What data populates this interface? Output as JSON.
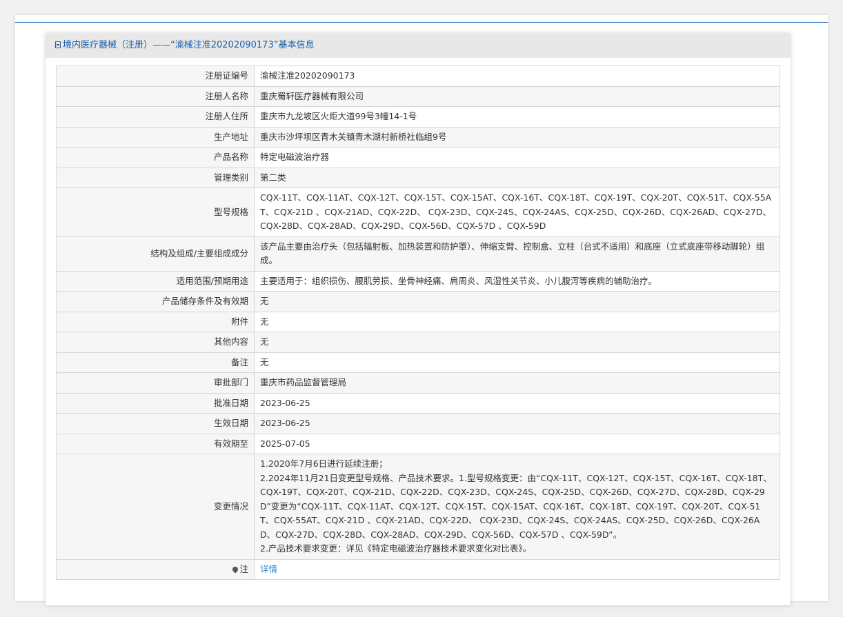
{
  "header": {
    "title": "境内医疗器械（注册）——“渝械注准20202090173”基本信息"
  },
  "rows": [
    {
      "label": "注册证编号",
      "value": "渝械注准20202090173"
    },
    {
      "label": "注册人名称",
      "value": "重庆蜀轩医疗器械有限公司"
    },
    {
      "label": "注册人住所",
      "value": "重庆市九龙坡区火炬大道99号3幢14-1号"
    },
    {
      "label": "生产地址",
      "value": "重庆市沙坪坝区青木关镇青木湖村新桥社临组9号"
    },
    {
      "label": "产品名称",
      "value": "特定电磁波治疗器"
    },
    {
      "label": "管理类别",
      "value": "第二类"
    },
    {
      "label": "型号规格",
      "value": "CQX-11T、CQX-11AT、CQX-12T、CQX-15T、CQX-15AT、CQX-16T、CQX-18T、CQX-19T、CQX-20T、CQX-51T、CQX-55AT、CQX-21D 、CQX-21AD、CQX-22D、 CQX-23D、CQX-24S、CQX-24AS、CQX-25D、CQX-26D、CQX-26AD、CQX-27D、CQX-28D、CQX-28AD、CQX-29D、CQX-56D、CQX-57D 、CQX-59D"
    },
    {
      "label": "结构及组成/主要组成成分",
      "value": "该产品主要由治疗头（包括辐射板、加热装置和防护罩）、伸缩支臂、控制盒、立柱（台式不适用）和底座（立式底座带移动脚轮）组成。"
    },
    {
      "label": "适用范围/预期用途",
      "value": "主要适用于：组织损伤、腰肌劳损、坐骨神经痛、肩周炎、风湿性关节炎、小儿腹泻等疾病的辅助治疗。"
    },
    {
      "label": "产品储存条件及有效期",
      "value": "无"
    },
    {
      "label": "附件",
      "value": "无"
    },
    {
      "label": "其他内容",
      "value": "无"
    },
    {
      "label": "备注",
      "value": "无"
    },
    {
      "label": "审批部门",
      "value": "重庆市药品监督管理局"
    },
    {
      "label": "批准日期",
      "value": "2023-06-25"
    },
    {
      "label": "生效日期",
      "value": "2023-06-25"
    },
    {
      "label": "有效期至",
      "value": "2025-07-05"
    }
  ],
  "changes": {
    "label": "变更情况",
    "line1": "1.2020年7月6日进行延续注册；",
    "line2": "2.2024年11月21日变更型号规格、产品技术要求。1.型号规格变更：由“CQX-11T、CQX-12T、CQX-15T、CQX-16T、CQX-18T、CQX-19T、CQX-20T、CQX-21D、CQX-22D、CQX-23D、CQX-24S、CQX-25D、CQX-26D、CQX-27D、CQX-28D、CQX-29D”变更为“CQX-11T、CQX-11AT、CQX-12T、CQX-15T、CQX-15AT、CQX-16T、CQX-18T、CQX-19T、CQX-20T、CQX-51T、CQX-55AT、CQX-21D 、CQX-21AD、CQX-22D、 CQX-23D、CQX-24S、CQX-24AS、CQX-25D、CQX-26D、CQX-26AD、CQX-27D、CQX-28D、CQX-28AD、CQX-29D、CQX-56D、CQX-57D 、CQX-59D”。",
    "line3": "2.产品技术要求变更：详见《特定电磁波治疗器技术要求变化对比表》。"
  },
  "note": {
    "label": "注",
    "link_text": "详情"
  }
}
